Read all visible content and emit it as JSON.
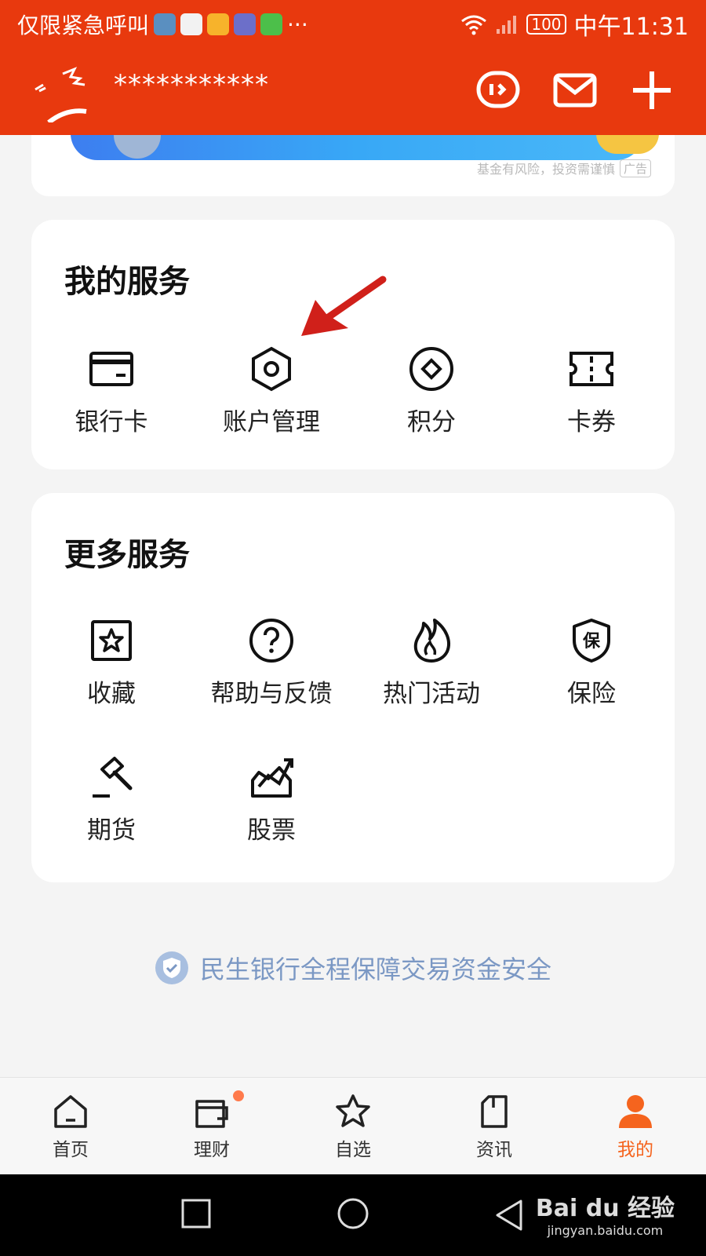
{
  "status_bar": {
    "carrier_text": "仅限紧急呼叫",
    "more": "···",
    "battery": "100",
    "time": "中午11:31"
  },
  "header": {
    "username": "*********** ",
    "icons": [
      "chat-bubble-icon",
      "mail-icon",
      "plus-icon"
    ]
  },
  "banner": {
    "disclaimer": "基金有风险，投资需谨慎",
    "ad_tag": "广告"
  },
  "my_services": {
    "title": "我的服务",
    "items": [
      {
        "label": "银行卡",
        "icon": "bank-card-icon"
      },
      {
        "label": "账户管理",
        "icon": "hexagon-settings-icon"
      },
      {
        "label": "积分",
        "icon": "points-diamond-icon"
      },
      {
        "label": "卡券",
        "icon": "ticket-icon"
      }
    ]
  },
  "more_services": {
    "title": "更多服务",
    "items": [
      {
        "label": "收藏",
        "icon": "star-box-icon"
      },
      {
        "label": "帮助与反馈",
        "icon": "question-circle-icon"
      },
      {
        "label": "热门活动",
        "icon": "flame-icon"
      },
      {
        "label": "保险",
        "icon": "shield-bao-icon"
      },
      {
        "label": "期货",
        "icon": "gavel-icon"
      },
      {
        "label": "股票",
        "icon": "trend-chart-icon"
      }
    ]
  },
  "guarantee": {
    "text": "民生银行全程保障交易资金安全"
  },
  "tab_bar": {
    "tabs": [
      {
        "label": "首页",
        "icon": "home-icon",
        "active": false
      },
      {
        "label": "理财",
        "icon": "wallet-icon",
        "active": false,
        "badge_dot": true
      },
      {
        "label": "自选",
        "icon": "star-icon",
        "active": false
      },
      {
        "label": "资讯",
        "icon": "document-icon",
        "active": false
      },
      {
        "label": "我的",
        "icon": "person-icon",
        "active": true
      }
    ]
  },
  "watermark": {
    "brand": "Bai du 经验",
    "url": "jingyan.baidu.com"
  },
  "colors": {
    "brand": "#e8390e",
    "active_tab": "#f5641e",
    "guarantee": "#7b98c4"
  }
}
